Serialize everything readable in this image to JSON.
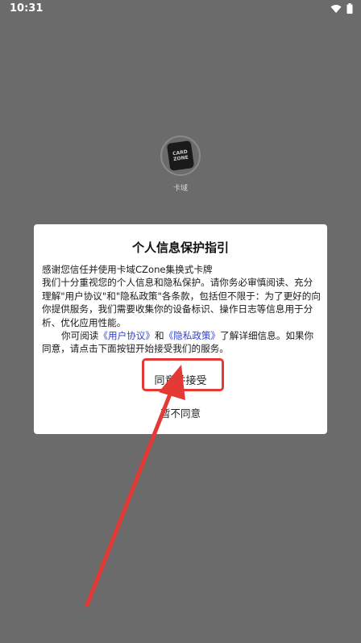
{
  "status_bar": {
    "time": "10:31"
  },
  "splash": {
    "logo_text_top": "CARD",
    "logo_text_bottom": "ZONE",
    "app_name": "卡域"
  },
  "dialog": {
    "title": "个人信息保护指引",
    "para1": "感谢您信任并使用卡域CZone集换式卡牌",
    "para2": "我们十分重视您的个人信息和隐私保护。请你务必审慎阅读、充分理解\"用户协议\"和\"隐私政策\"各条款，包括但不限于：为了更好的向你提供服务，我们需要收集你的设备标识、操作日志等信息用于分析、优化应用性能。",
    "para3_prefix": "你可阅读",
    "user_agreement_link": "《用户协议》",
    "para3_and": "和",
    "privacy_policy_link": "《隐私政策》",
    "para3_suffix": "了解详细信息。如果你同意，请点击下面按钮开始接受我们的服务。",
    "agree_button": "同意并接受",
    "disagree_button": "暂不同意"
  },
  "colors": {
    "link": "#2f3fd6",
    "highlight": "#e53935",
    "overlay": "#6b6b6b"
  }
}
